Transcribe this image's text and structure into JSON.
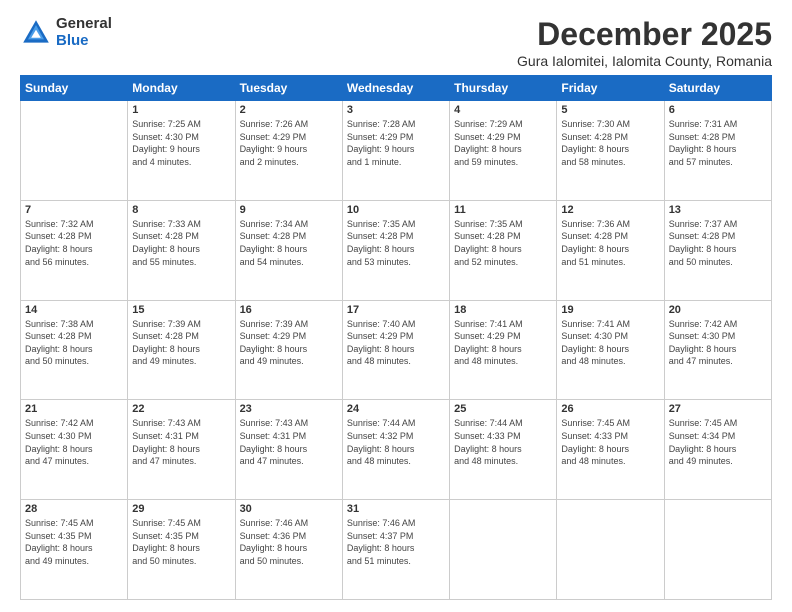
{
  "logo": {
    "general": "General",
    "blue": "Blue"
  },
  "header": {
    "month": "December 2025",
    "location": "Gura Ialomitei, Ialomita County, Romania"
  },
  "weekdays": [
    "Sunday",
    "Monday",
    "Tuesday",
    "Wednesday",
    "Thursday",
    "Friday",
    "Saturday"
  ],
  "weeks": [
    [
      {
        "day": "",
        "info": ""
      },
      {
        "day": "1",
        "info": "Sunrise: 7:25 AM\nSunset: 4:30 PM\nDaylight: 9 hours\nand 4 minutes."
      },
      {
        "day": "2",
        "info": "Sunrise: 7:26 AM\nSunset: 4:29 PM\nDaylight: 9 hours\nand 2 minutes."
      },
      {
        "day": "3",
        "info": "Sunrise: 7:28 AM\nSunset: 4:29 PM\nDaylight: 9 hours\nand 1 minute."
      },
      {
        "day": "4",
        "info": "Sunrise: 7:29 AM\nSunset: 4:29 PM\nDaylight: 8 hours\nand 59 minutes."
      },
      {
        "day": "5",
        "info": "Sunrise: 7:30 AM\nSunset: 4:28 PM\nDaylight: 8 hours\nand 58 minutes."
      },
      {
        "day": "6",
        "info": "Sunrise: 7:31 AM\nSunset: 4:28 PM\nDaylight: 8 hours\nand 57 minutes."
      }
    ],
    [
      {
        "day": "7",
        "info": "Sunrise: 7:32 AM\nSunset: 4:28 PM\nDaylight: 8 hours\nand 56 minutes."
      },
      {
        "day": "8",
        "info": "Sunrise: 7:33 AM\nSunset: 4:28 PM\nDaylight: 8 hours\nand 55 minutes."
      },
      {
        "day": "9",
        "info": "Sunrise: 7:34 AM\nSunset: 4:28 PM\nDaylight: 8 hours\nand 54 minutes."
      },
      {
        "day": "10",
        "info": "Sunrise: 7:35 AM\nSunset: 4:28 PM\nDaylight: 8 hours\nand 53 minutes."
      },
      {
        "day": "11",
        "info": "Sunrise: 7:35 AM\nSunset: 4:28 PM\nDaylight: 8 hours\nand 52 minutes."
      },
      {
        "day": "12",
        "info": "Sunrise: 7:36 AM\nSunset: 4:28 PM\nDaylight: 8 hours\nand 51 minutes."
      },
      {
        "day": "13",
        "info": "Sunrise: 7:37 AM\nSunset: 4:28 PM\nDaylight: 8 hours\nand 50 minutes."
      }
    ],
    [
      {
        "day": "14",
        "info": "Sunrise: 7:38 AM\nSunset: 4:28 PM\nDaylight: 8 hours\nand 50 minutes."
      },
      {
        "day": "15",
        "info": "Sunrise: 7:39 AM\nSunset: 4:28 PM\nDaylight: 8 hours\nand 49 minutes."
      },
      {
        "day": "16",
        "info": "Sunrise: 7:39 AM\nSunset: 4:29 PM\nDaylight: 8 hours\nand 49 minutes."
      },
      {
        "day": "17",
        "info": "Sunrise: 7:40 AM\nSunset: 4:29 PM\nDaylight: 8 hours\nand 48 minutes."
      },
      {
        "day": "18",
        "info": "Sunrise: 7:41 AM\nSunset: 4:29 PM\nDaylight: 8 hours\nand 48 minutes."
      },
      {
        "day": "19",
        "info": "Sunrise: 7:41 AM\nSunset: 4:30 PM\nDaylight: 8 hours\nand 48 minutes."
      },
      {
        "day": "20",
        "info": "Sunrise: 7:42 AM\nSunset: 4:30 PM\nDaylight: 8 hours\nand 47 minutes."
      }
    ],
    [
      {
        "day": "21",
        "info": "Sunrise: 7:42 AM\nSunset: 4:30 PM\nDaylight: 8 hours\nand 47 minutes."
      },
      {
        "day": "22",
        "info": "Sunrise: 7:43 AM\nSunset: 4:31 PM\nDaylight: 8 hours\nand 47 minutes."
      },
      {
        "day": "23",
        "info": "Sunrise: 7:43 AM\nSunset: 4:31 PM\nDaylight: 8 hours\nand 47 minutes."
      },
      {
        "day": "24",
        "info": "Sunrise: 7:44 AM\nSunset: 4:32 PM\nDaylight: 8 hours\nand 48 minutes."
      },
      {
        "day": "25",
        "info": "Sunrise: 7:44 AM\nSunset: 4:33 PM\nDaylight: 8 hours\nand 48 minutes."
      },
      {
        "day": "26",
        "info": "Sunrise: 7:45 AM\nSunset: 4:33 PM\nDaylight: 8 hours\nand 48 minutes."
      },
      {
        "day": "27",
        "info": "Sunrise: 7:45 AM\nSunset: 4:34 PM\nDaylight: 8 hours\nand 49 minutes."
      }
    ],
    [
      {
        "day": "28",
        "info": "Sunrise: 7:45 AM\nSunset: 4:35 PM\nDaylight: 8 hours\nand 49 minutes."
      },
      {
        "day": "29",
        "info": "Sunrise: 7:45 AM\nSunset: 4:35 PM\nDaylight: 8 hours\nand 50 minutes."
      },
      {
        "day": "30",
        "info": "Sunrise: 7:46 AM\nSunset: 4:36 PM\nDaylight: 8 hours\nand 50 minutes."
      },
      {
        "day": "31",
        "info": "Sunrise: 7:46 AM\nSunset: 4:37 PM\nDaylight: 8 hours\nand 51 minutes."
      },
      {
        "day": "",
        "info": ""
      },
      {
        "day": "",
        "info": ""
      },
      {
        "day": "",
        "info": ""
      }
    ]
  ]
}
